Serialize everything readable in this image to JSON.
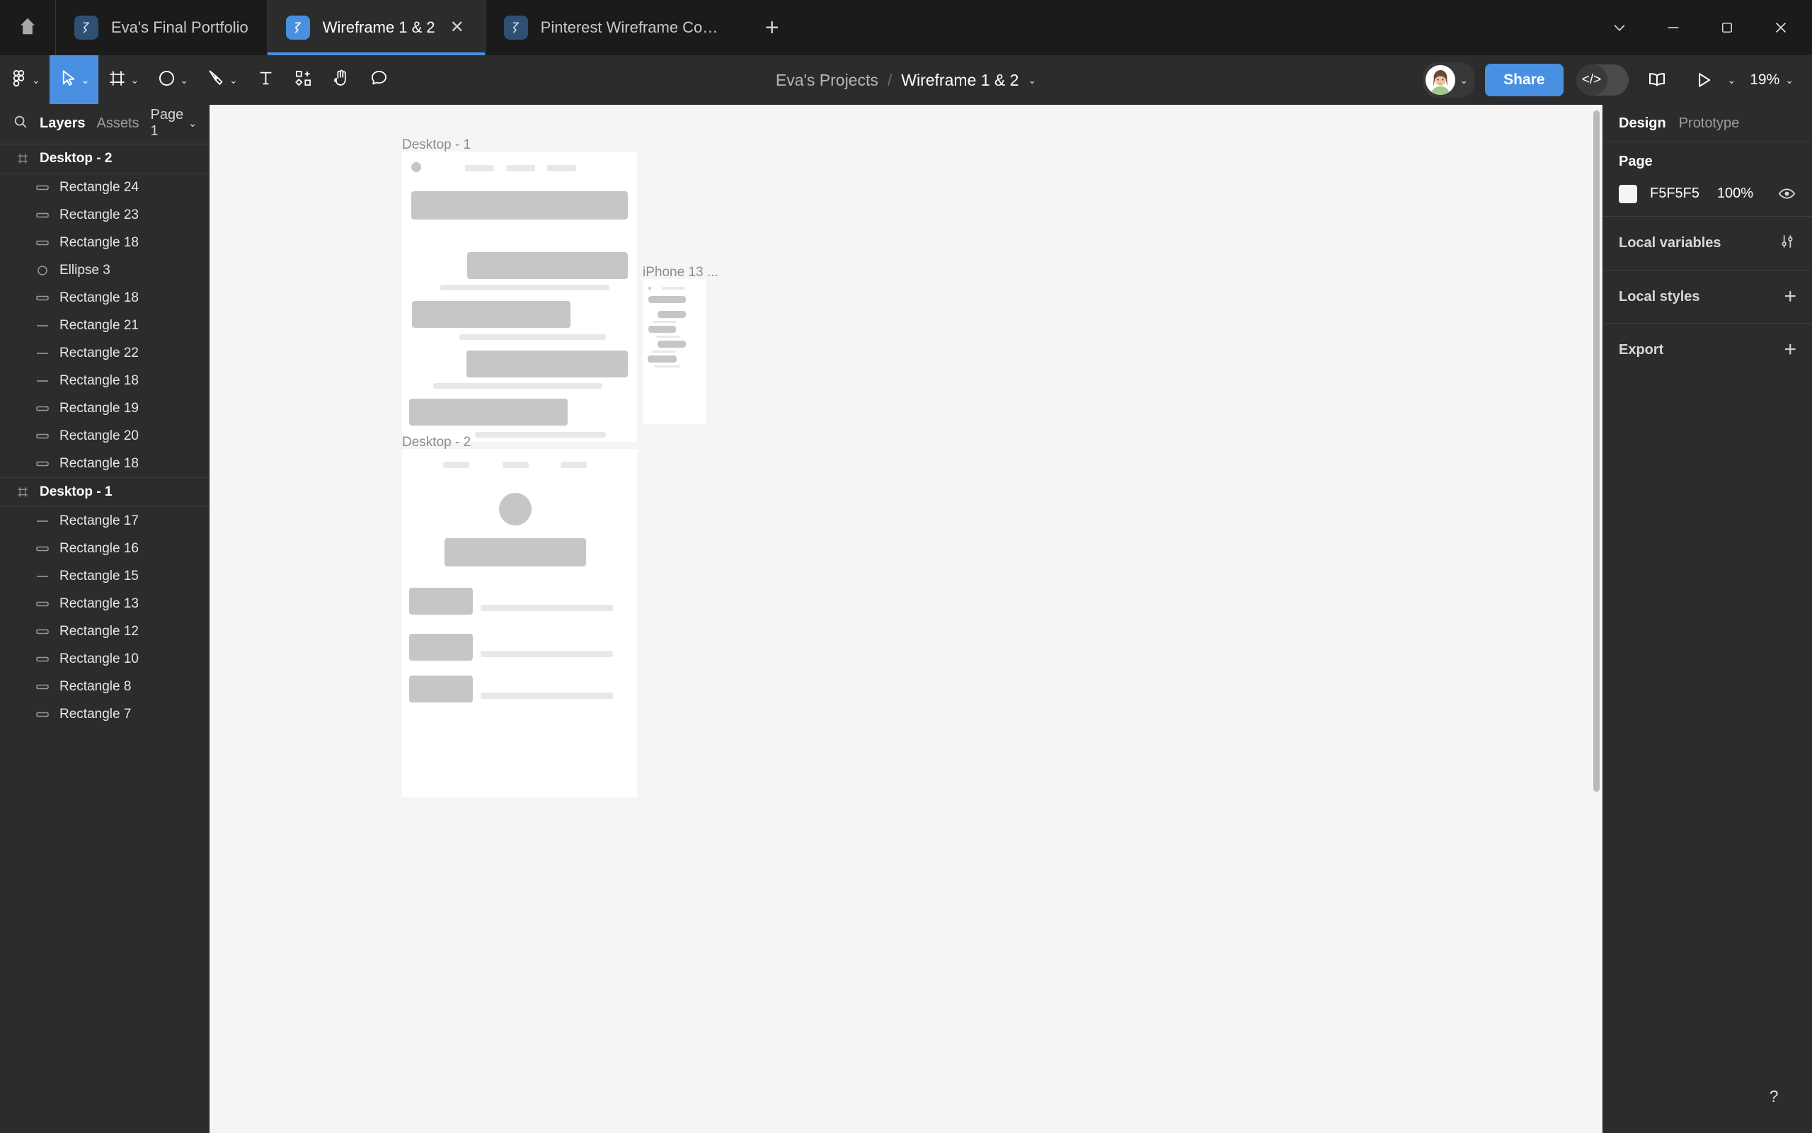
{
  "browser": {
    "home_icon": "home-icon",
    "tabs": [
      {
        "title": "Eva's Final Portfolio",
        "favicon": "figma-icon",
        "active": false,
        "closable": false
      },
      {
        "title": "Wireframe 1 & 2",
        "favicon": "figma-icon",
        "active": true,
        "closable": true,
        "close_glyph": "✕"
      },
      {
        "title": "Pinterest Wireframe Comparison",
        "favicon": "figma-icon",
        "active": false,
        "closable": false
      }
    ],
    "new_tab_glyph": "+",
    "window_controls": [
      {
        "name": "tab-search-button",
        "glyph": "chevron-down-icon"
      },
      {
        "name": "minimize-button",
        "glyph": "minimize-icon"
      },
      {
        "name": "maximize-button",
        "glyph": "maximize-icon"
      },
      {
        "name": "close-window-button",
        "glyph": "close-icon"
      }
    ]
  },
  "toolbar": {
    "tools": [
      {
        "name": "figma-menu",
        "icon": "figma-logo-icon",
        "has_chevron": true,
        "active": false
      },
      {
        "name": "move-tool",
        "icon": "cursor-arrow-icon",
        "has_chevron": true,
        "active": true
      },
      {
        "name": "frame-tool",
        "icon": "frame-icon",
        "has_chevron": true,
        "active": false
      },
      {
        "name": "shape-tool",
        "icon": "ellipse-icon",
        "has_chevron": true,
        "active": false
      },
      {
        "name": "pen-tool",
        "icon": "pen-icon",
        "has_chevron": true,
        "active": false
      },
      {
        "name": "text-tool",
        "icon": "text-icon",
        "has_chevron": false,
        "active": false
      },
      {
        "name": "resources-tool",
        "icon": "components-grid-icon",
        "has_chevron": false,
        "active": false
      },
      {
        "name": "hand-tool",
        "icon": "hand-icon",
        "has_chevron": false,
        "active": false
      },
      {
        "name": "comment-tool",
        "icon": "comment-bubble-icon",
        "has_chevron": false,
        "active": false
      }
    ],
    "chevron_glyph": "⌄",
    "breadcrumb": {
      "project": "Eva's Projects",
      "separator": "/",
      "file": "Wireframe 1 & 2"
    },
    "share_label": "Share",
    "dev_mode_glyph": "</>",
    "zoom_level": "19%",
    "right_icons": [
      {
        "name": "library-book-icon"
      },
      {
        "name": "present-play-icon"
      }
    ]
  },
  "left_panel": {
    "search_icon": "search-icon",
    "tabs": [
      {
        "label": "Layers",
        "active": true
      },
      {
        "label": "Assets",
        "active": false
      }
    ],
    "page_selector": "Page 1",
    "layers": [
      {
        "label": "Desktop - 2",
        "type": "frame",
        "icon": "frame-icon"
      },
      {
        "label": "Rectangle 24",
        "type": "rectangle",
        "icon": "rectangle-icon"
      },
      {
        "label": "Rectangle 23",
        "type": "rectangle",
        "icon": "rectangle-icon"
      },
      {
        "label": "Rectangle 18",
        "type": "rectangle",
        "icon": "rectangle-icon"
      },
      {
        "label": "Ellipse 3",
        "type": "ellipse",
        "icon": "ellipse-icon"
      },
      {
        "label": "Rectangle 18",
        "type": "rectangle",
        "icon": "rectangle-icon"
      },
      {
        "label": "Rectangle 21",
        "type": "line",
        "icon": "line-icon"
      },
      {
        "label": "Rectangle 22",
        "type": "line",
        "icon": "line-icon"
      },
      {
        "label": "Rectangle 18",
        "type": "line",
        "icon": "line-icon"
      },
      {
        "label": "Rectangle 19",
        "type": "rectangle",
        "icon": "rectangle-icon"
      },
      {
        "label": "Rectangle 20",
        "type": "rectangle",
        "icon": "rectangle-icon"
      },
      {
        "label": "Rectangle 18",
        "type": "rectangle",
        "icon": "rectangle-icon"
      },
      {
        "label": "Desktop - 1",
        "type": "frame",
        "icon": "frame-icon"
      },
      {
        "label": "Rectangle 17",
        "type": "line",
        "icon": "line-icon"
      },
      {
        "label": "Rectangle 16",
        "type": "rectangle",
        "icon": "rectangle-icon"
      },
      {
        "label": "Rectangle 15",
        "type": "line",
        "icon": "line-icon"
      },
      {
        "label": "Rectangle 13",
        "type": "rectangle",
        "icon": "rectangle-icon"
      },
      {
        "label": "Rectangle 12",
        "type": "rectangle",
        "icon": "rectangle-icon"
      },
      {
        "label": "Rectangle 10",
        "type": "rectangle",
        "icon": "rectangle-icon"
      },
      {
        "label": "Rectangle 8",
        "type": "rectangle",
        "icon": "rectangle-icon"
      },
      {
        "label": "Rectangle 7",
        "type": "rectangle",
        "icon": "rectangle-icon"
      }
    ]
  },
  "canvas": {
    "frames": [
      {
        "name": "desktop-1-frame",
        "label": "Desktop - 1"
      },
      {
        "name": "desktop-2-frame",
        "label": "Desktop - 2"
      },
      {
        "name": "iphone-13-frame",
        "label": "iPhone 13 ..."
      }
    ]
  },
  "right_panel": {
    "tabs": [
      {
        "label": "Design",
        "active": true
      },
      {
        "label": "Prototype",
        "active": false
      }
    ],
    "page_section": {
      "title": "Page",
      "color_hex": "F5F5F5",
      "color_value": "#F5F5F5",
      "opacity": "100%",
      "visibility_icon": "eye-icon"
    },
    "sections": [
      {
        "title": "Local variables",
        "action_icon": "sliders-icon",
        "action_glyph": ""
      },
      {
        "title": "Local styles",
        "action_icon": "plus-icon",
        "action_glyph": "+"
      },
      {
        "title": "Export",
        "action_icon": "plus-icon",
        "action_glyph": "+"
      }
    ]
  },
  "help": {
    "glyph": "?"
  },
  "colors": {
    "accent_blue": "#4a90e2",
    "chrome_dark": "#1b1b1b",
    "panel_dark": "#2c2c2c",
    "canvas_bg": "#f5f5f5",
    "wireframe_block": "#c6c6c6",
    "wireframe_light": "#e8e8e8"
  }
}
